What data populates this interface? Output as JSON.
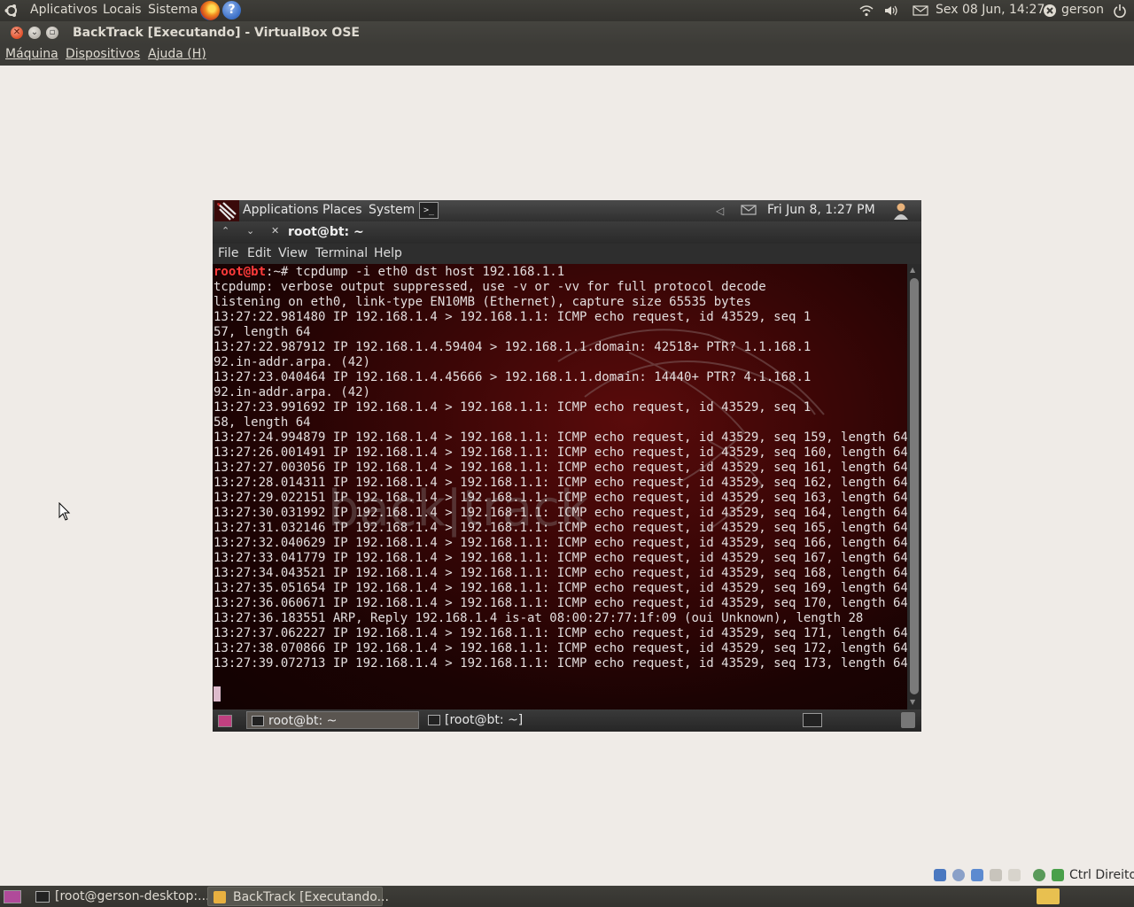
{
  "host_top_panel": {
    "menus": [
      "Aplicativos",
      "Locais",
      "Sistema"
    ],
    "datetime": "Sex 08 Jun, 14:27",
    "user": "gerson",
    "icons": [
      "ubuntu-logo-icon",
      "firefox-icon",
      "help-icon",
      "wifi-icon",
      "volume-icon",
      "mail-icon",
      "user-status-icon",
      "power-icon"
    ]
  },
  "vbox_window": {
    "title": "BackTrack [Executando] - VirtualBox OSE",
    "menus": [
      "Máquina",
      "Dispositivos",
      "Ajuda (H)"
    ]
  },
  "guest": {
    "panel": {
      "menus": [
        "Applications",
        "Places",
        "System"
      ],
      "datetime": "Fri Jun  8,  1:27 PM"
    },
    "terminal": {
      "title": "root@bt: ~",
      "menus": [
        "File",
        "Edit",
        "View",
        "Terminal",
        "Help"
      ],
      "prompt_user": "root@bt",
      "prompt_rest": ":~# tcpdump -i eth0 dst host 192.168.1.1",
      "lines": [
        "tcpdump: verbose output suppressed, use -v or -vv for full protocol decode",
        "listening on eth0, link-type EN10MB (Ethernet), capture size 65535 bytes",
        "13:27:22.981480 IP 192.168.1.4 > 192.168.1.1: ICMP echo request, id 43529, seq 1",
        "57, length 64",
        "13:27:22.987912 IP 192.168.1.4.59404 > 192.168.1.1.domain: 42518+ PTR? 1.1.168.1",
        "92.in-addr.arpa. (42)",
        "13:27:23.040464 IP 192.168.1.4.45666 > 192.168.1.1.domain: 14440+ PTR? 4.1.168.1",
        "92.in-addr.arpa. (42)",
        "13:27:23.991692 IP 192.168.1.4 > 192.168.1.1: ICMP echo request, id 43529, seq 1",
        "58, length 64",
        "13:27:24.994879 IP 192.168.1.4 > 192.168.1.1: ICMP echo request, id 43529, seq 159, length 64",
        "13:27:26.001491 IP 192.168.1.4 > 192.168.1.1: ICMP echo request, id 43529, seq 160, length 64",
        "13:27:27.003056 IP 192.168.1.4 > 192.168.1.1: ICMP echo request, id 43529, seq 161, length 64",
        "13:27:28.014311 IP 192.168.1.4 > 192.168.1.1: ICMP echo request, id 43529, seq 162, length 64",
        "13:27:29.022151 IP 192.168.1.4 > 192.168.1.1: ICMP echo request, id 43529, seq 163, length 64",
        "13:27:30.031992 IP 192.168.1.4 > 192.168.1.1: ICMP echo request, id 43529, seq 164, length 64",
        "13:27:31.032146 IP 192.168.1.4 > 192.168.1.1: ICMP echo request, id 43529, seq 165, length 64",
        "13:27:32.040629 IP 192.168.1.4 > 192.168.1.1: ICMP echo request, id 43529, seq 166, length 64",
        "13:27:33.041779 IP 192.168.1.4 > 192.168.1.1: ICMP echo request, id 43529, seq 167, length 64",
        "13:27:34.043521 IP 192.168.1.4 > 192.168.1.1: ICMP echo request, id 43529, seq 168, length 64",
        "13:27:35.051654 IP 192.168.1.4 > 192.168.1.1: ICMP echo request, id 43529, seq 169, length 64",
        "13:27:36.060671 IP 192.168.1.4 > 192.168.1.1: ICMP echo request, id 43529, seq 170, length 64",
        "13:27:36.183551 ARP, Reply 192.168.1.4 is-at 08:00:27:77:1f:09 (oui Unknown), length 28",
        "13:27:37.062227 IP 192.168.1.4 > 192.168.1.1: ICMP echo request, id 43529, seq 171, length 64",
        "13:27:38.070866 IP 192.168.1.4 > 192.168.1.1: ICMP echo request, id 43529, seq 172, length 64",
        "13:27:39.072713 IP 192.168.1.4 > 192.168.1.1: ICMP echo request, id 43529, seq 173, length 64"
      ],
      "watermark": "back|track"
    },
    "taskbar": {
      "tasks": [
        "root@bt: ~",
        "[root@bt: ~]"
      ]
    }
  },
  "vbox_status": {
    "host_key": "Ctrl Direito"
  },
  "host_bottom_panel": {
    "tasks": [
      "[root@gerson-desktop:...",
      "BackTrack [Executando..."
    ]
  },
  "colors": {
    "prompt": "#ff3b3b",
    "terminal_text": "#e3dede",
    "panel": "#3c3b37"
  }
}
